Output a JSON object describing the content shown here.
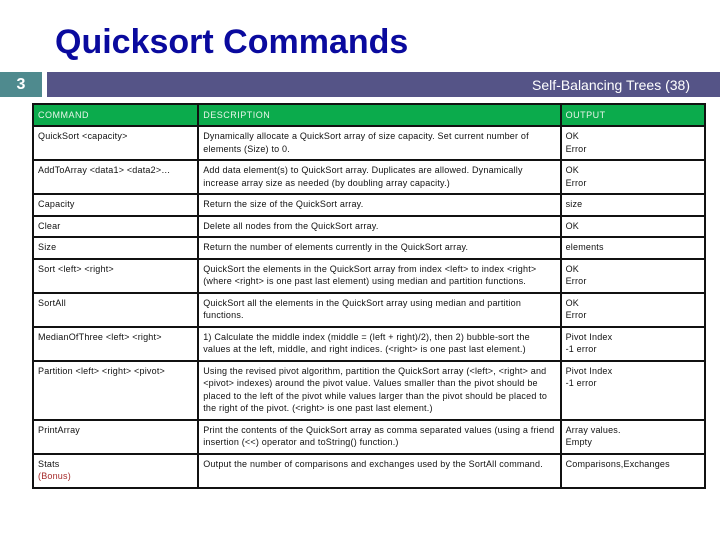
{
  "slide": {
    "title": "Quicksort Commands",
    "number": "3",
    "header_text": "Self-Balancing Trees (38)"
  },
  "table": {
    "headers": [
      "COMMAND",
      "DESCRIPTION",
      "OUTPUT"
    ],
    "rows": [
      {
        "command": "QuickSort <capacity>",
        "command_note": "",
        "description": "Dynamically allocate a QuickSort array of size capacity. Set current number of elements (Size) to 0.",
        "output": [
          "OK",
          "Error"
        ]
      },
      {
        "command": "AddToArray <data1> <data2>…",
        "command_note": "",
        "description": "Add data element(s) to QuickSort array. Duplicates are allowed. Dynamically increase array size as needed (by doubling array capacity.)",
        "output": [
          "OK",
          "Error"
        ]
      },
      {
        "command": "Capacity",
        "command_note": "",
        "description": "Return the size of the QuickSort array.",
        "output": [
          "size"
        ]
      },
      {
        "command": "Clear",
        "command_note": "",
        "description": "Delete all nodes from the QuickSort array.",
        "output": [
          "OK"
        ]
      },
      {
        "command": "Size",
        "command_note": "",
        "description": "Return the number of elements currently in the QuickSort array.",
        "output": [
          "elements"
        ]
      },
      {
        "command": "Sort <left> <right>",
        "command_note": "",
        "description": "QuickSort the elements in the QuickSort array from index <left> to index <right> (where <right> is one past last element) using median and partition functions.",
        "output": [
          "OK",
          "Error"
        ]
      },
      {
        "command": "SortAll",
        "command_note": "",
        "description": "QuickSort all the elements in the QuickSort array using median and partition functions.",
        "output": [
          "OK",
          "Error"
        ]
      },
      {
        "command": "MedianOfThree <left> <right>",
        "command_note": "",
        "description": "1) Calculate the middle index (middle = (left + right)/2), then 2) bubble-sort the values at the left, middle, and right indices. (<right> is one past last element.)",
        "output": [
          "Pivot Index",
          "-1 error"
        ]
      },
      {
        "command": "Partition <left> <right> <pivot>",
        "command_note": "",
        "description": "Using the revised pivot algorithm, partition the QuickSort array (<left>, <right> and <pivot> indexes) around the pivot value. Values smaller than the pivot should be placed to the left of the pivot while values larger than the pivot should be placed to the right of the pivot. (<right> is one past last element.)",
        "output": [
          "Pivot Index",
          "-1 error"
        ]
      },
      {
        "command": "PrintArray",
        "command_note": "",
        "description": "Print the contents of the QuickSort array as comma separated values (using a friend insertion (<<) operator and toString() function.)",
        "output": [
          "Array values.",
          "Empty"
        ]
      },
      {
        "command": "Stats",
        "command_note": "(Bonus)",
        "description": "Output the number of comparisons and exchanges used by the SortAll command.",
        "output": [
          "Comparisons,Exchanges"
        ]
      }
    ]
  },
  "colors": {
    "title": "#0a0a9e",
    "slide_number_bg": "#4f8a8e",
    "header_bar_bg": "#555487",
    "table_header_bg": "#0bab4c",
    "bonus_text": "#a52a2a"
  }
}
